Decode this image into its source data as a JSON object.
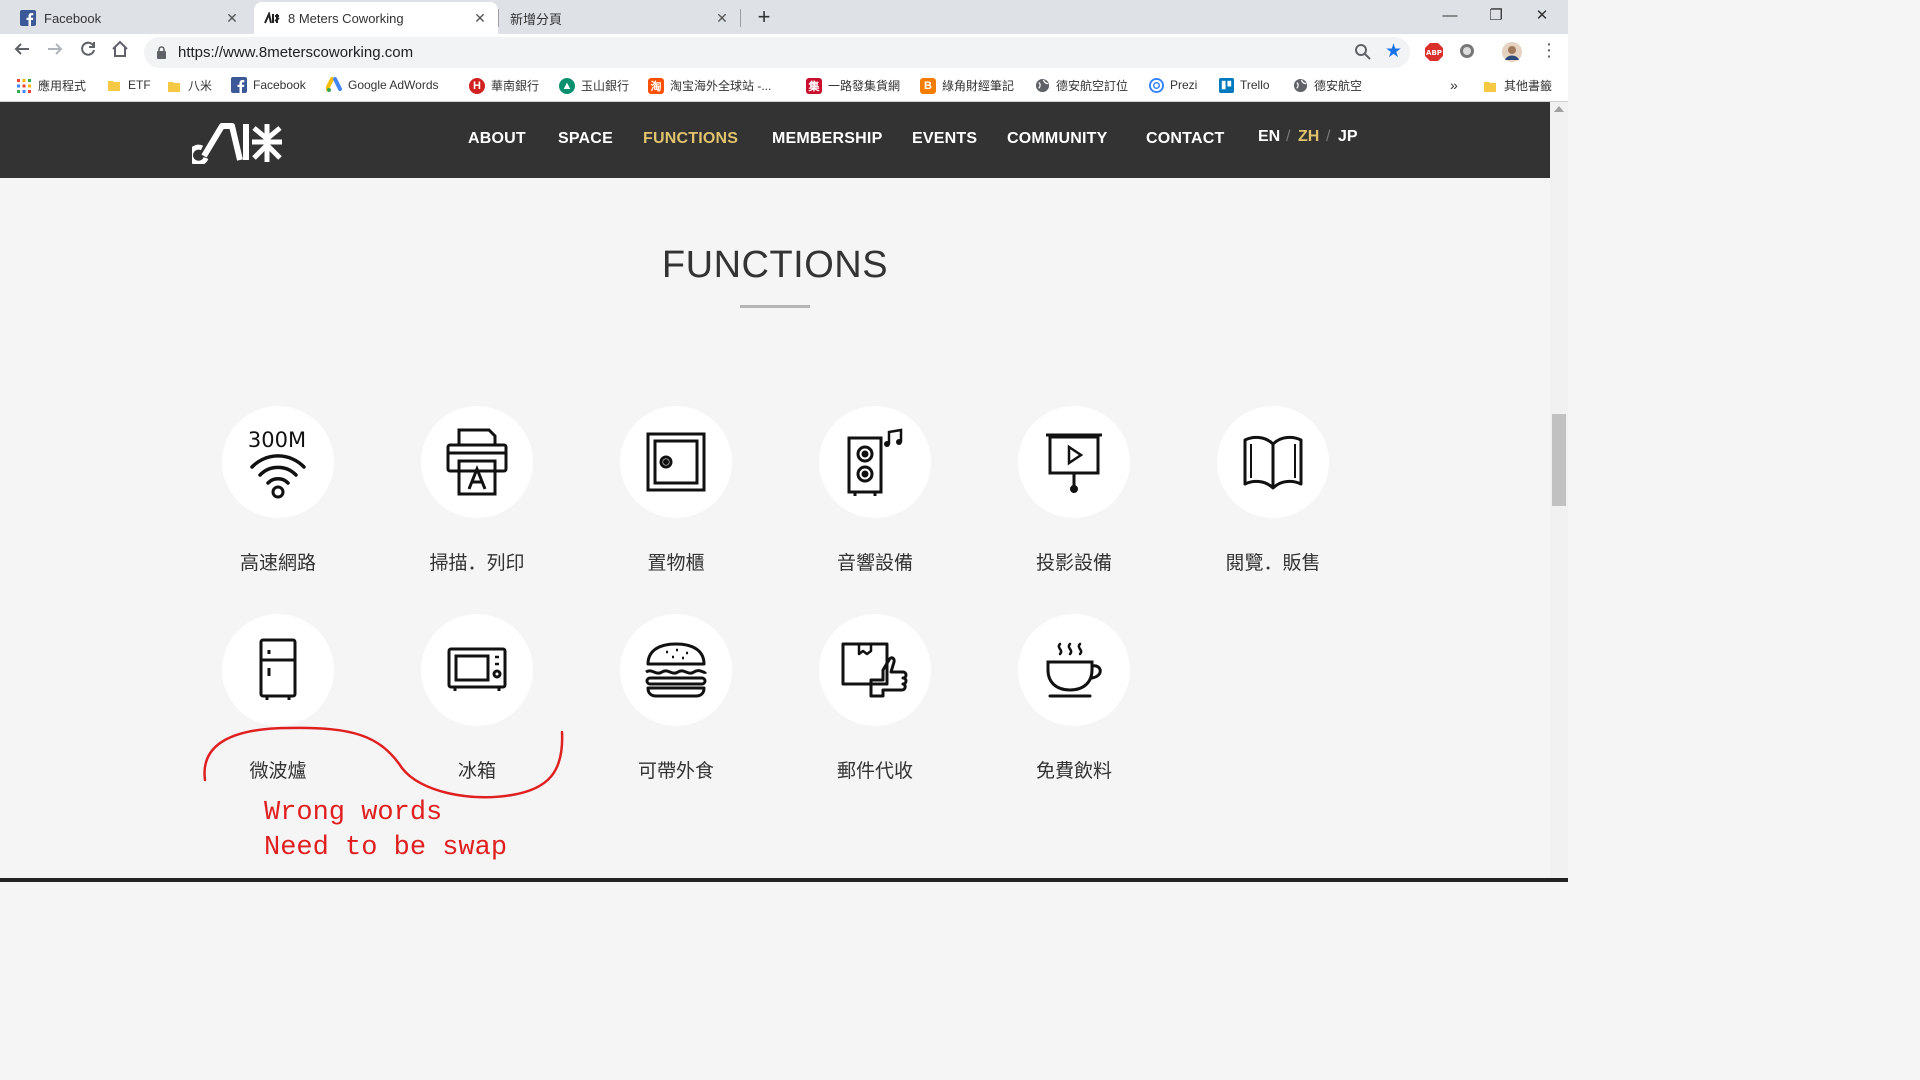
{
  "browser": {
    "tabs": [
      {
        "title": "Facebook",
        "close": "✕"
      },
      {
        "title": "8 Meters Coworking",
        "close": "✕"
      },
      {
        "title": "新增分頁",
        "close": "✕"
      }
    ],
    "new_tab": "+",
    "window_controls": {
      "minimize": "—",
      "restore": "❐",
      "close": "✕"
    },
    "url": "https://www.8meterscoworking.com",
    "bookmarks": [
      "應用程式",
      "ETF",
      "八米",
      "Facebook",
      "Google AdWords",
      "華南銀行",
      "玉山銀行",
      "淘宝海外全球站 -...",
      "一路發集貨網",
      "綠角財經筆記",
      "德安航空訂位",
      "Prezi",
      "Trello",
      "德安航空"
    ],
    "bookmarks_overflow": "»",
    "other_bookmarks": "其他書籤",
    "accent_color": "#1a73e8"
  },
  "site": {
    "menu": [
      "ABOUT",
      "SPACE",
      "FUNCTIONS",
      "MEMBERSHIP",
      "EVENTS",
      "COMMUNITY",
      "CONTACT"
    ],
    "active_menu": "FUNCTIONS",
    "languages": [
      "EN",
      "ZH",
      "JP"
    ],
    "language_separator": "/",
    "active_language": "ZH",
    "header_color": "#333333",
    "accent_color": "#e0c36c"
  },
  "page": {
    "title": "FUNCTIONS",
    "features": [
      {
        "label": "高速網路",
        "icon": "wifi-300m-icon",
        "badge": "300M"
      },
      {
        "label": "掃描．列印",
        "icon": "printer-icon"
      },
      {
        "label": "置物櫃",
        "icon": "locker-icon"
      },
      {
        "label": "音響設備",
        "icon": "speaker-icon"
      },
      {
        "label": "投影設備",
        "icon": "projector-icon"
      },
      {
        "label": "閱覽．販售",
        "icon": "book-icon"
      },
      {
        "label": "微波爐",
        "icon": "fridge-icon"
      },
      {
        "label": "冰箱",
        "icon": "microwave-icon"
      },
      {
        "label": "可帶外食",
        "icon": "burger-icon"
      },
      {
        "label": "郵件代收",
        "icon": "parcel-icon"
      },
      {
        "label": "免費飲料",
        "icon": "coffee-cup-icon"
      }
    ]
  },
  "annotation": {
    "line1": "Wrong words",
    "line2": "Need to be swap",
    "color": "#e02020"
  }
}
